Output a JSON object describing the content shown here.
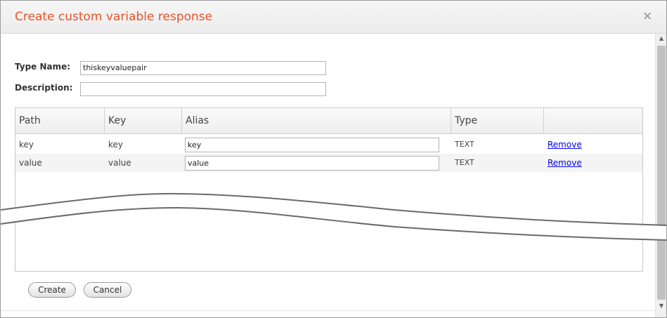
{
  "dialog": {
    "title": "Create custom variable response",
    "close_glyph": "×"
  },
  "form": {
    "type_name_label": "Type Name:",
    "type_name_value": "thiskeyvaluepair",
    "description_label": "Description:",
    "description_value": ""
  },
  "grid": {
    "columns": [
      "Path",
      "Key",
      "Alias",
      "Type",
      ""
    ],
    "rows": [
      {
        "path": "key",
        "key": "key",
        "alias": "key",
        "type": "TEXT",
        "action": "Remove"
      },
      {
        "path": "value",
        "key": "value",
        "alias": "value",
        "type": "TEXT",
        "action": "Remove"
      }
    ]
  },
  "buttons": {
    "create": "Create",
    "cancel": "Cancel"
  },
  "scrollbar": {
    "up_glyph": "▲",
    "down_glyph": "▼"
  },
  "colors": {
    "title": "#e8542a",
    "link": "#0000ee"
  }
}
